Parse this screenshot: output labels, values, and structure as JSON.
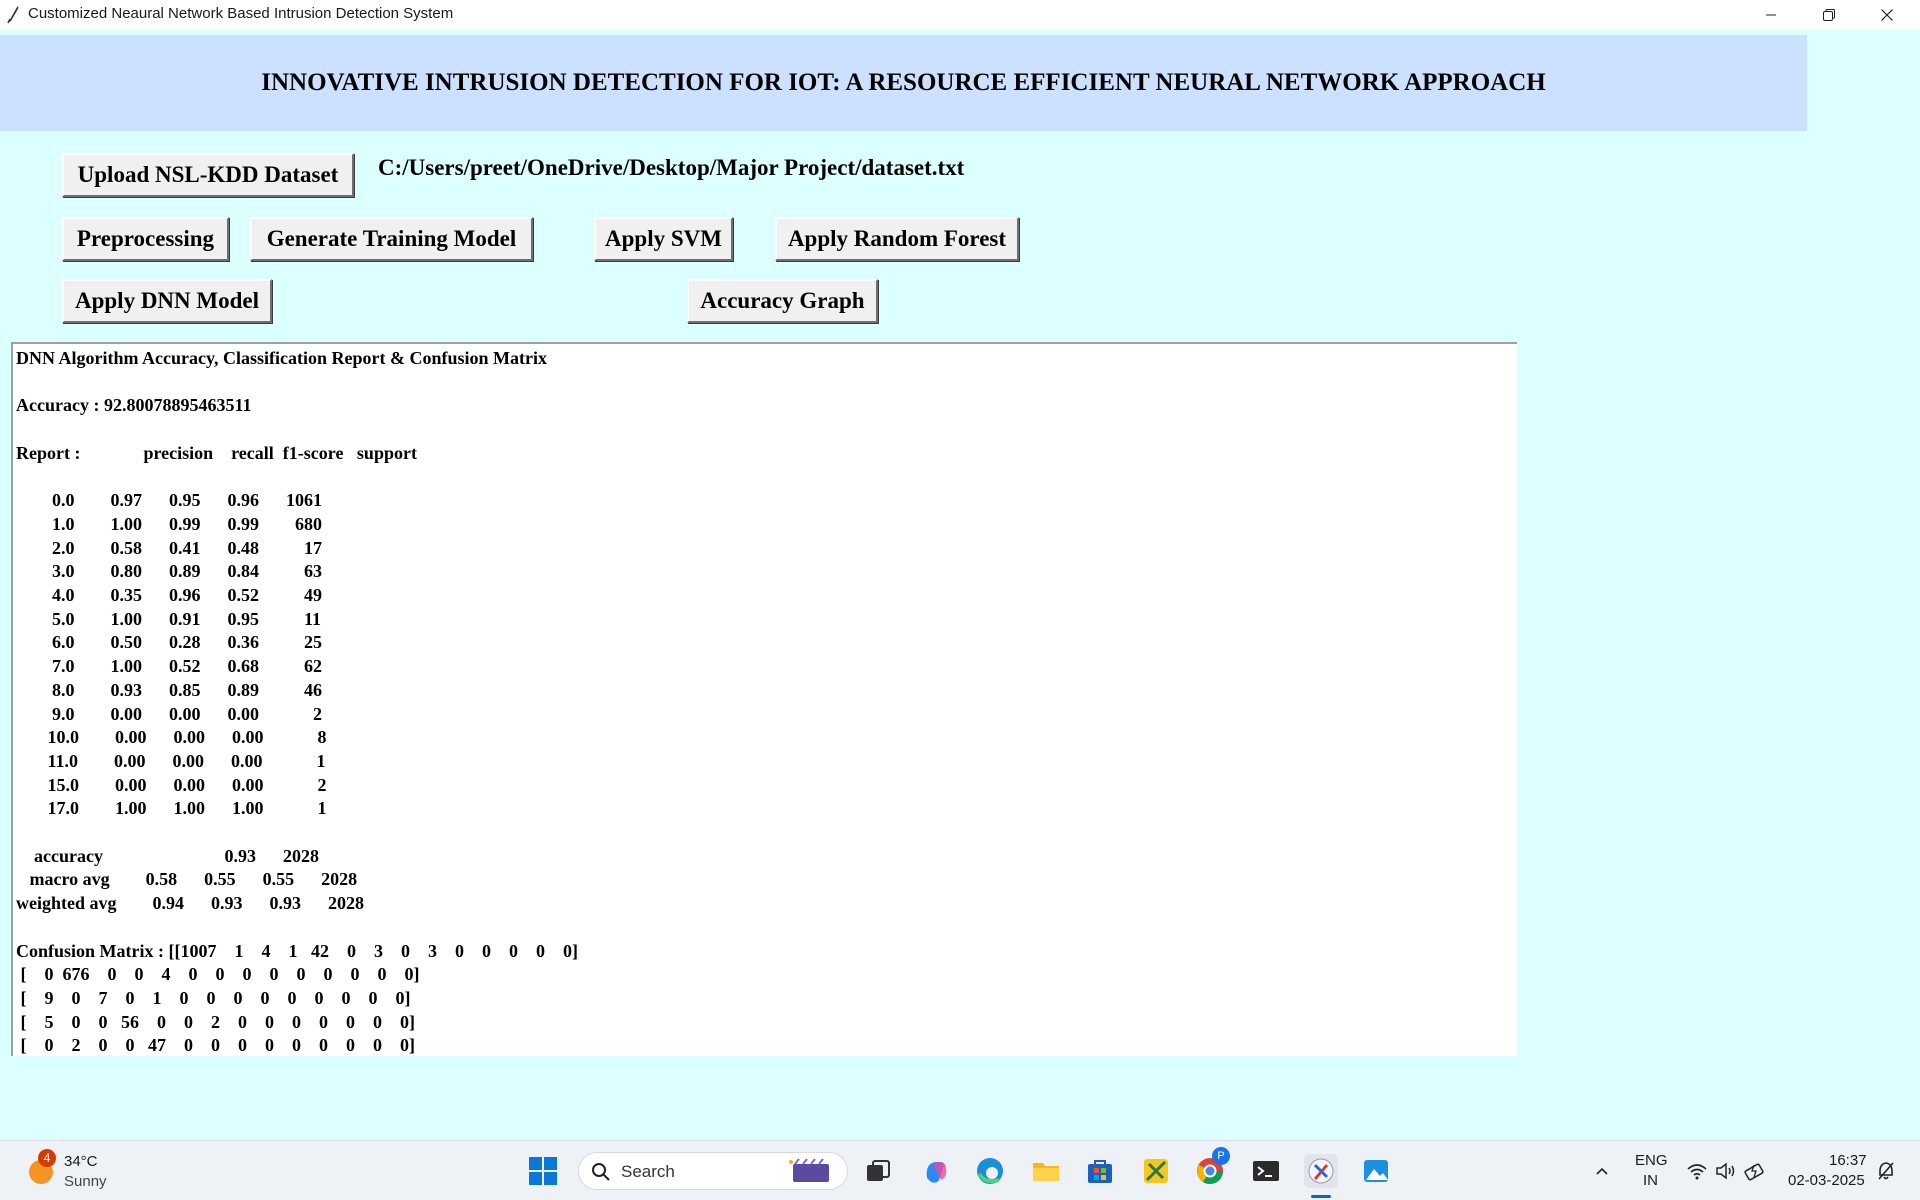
{
  "window": {
    "title": "Customized Neaural Network Based Intrusion Detection System"
  },
  "header": {
    "title": "INNOVATIVE INTRUSION DETECTION FOR IOT: A RESOURCE EFFICIENT NEURAL NETWORK APPROACH"
  },
  "buttons": {
    "upload": "Upload NSL-KDD Dataset",
    "preprocessing": "Preprocessing",
    "generate": "Generate Training Model",
    "svm": "Apply SVM",
    "random_forest": "Apply Random Forest",
    "dnn": "Apply DNN Model",
    "accuracy_graph": "Accuracy Graph"
  },
  "dataset_path": "C:/Users/preet/OneDrive/Desktop/Major Project/dataset.txt",
  "output": {
    "lines": [
      "DNN Algorithm Accuracy, Classification Report & Confusion Matrix",
      "",
      "Accuracy : 92.80078895463511",
      "",
      "Report :              precision    recall  f1-score   support",
      "",
      "        0.0        0.97      0.95      0.96      1061",
      "        1.0        1.00      0.99      0.99        680",
      "        2.0        0.58      0.41      0.48          17",
      "        3.0        0.80      0.89      0.84          63",
      "        4.0        0.35      0.96      0.52          49",
      "        5.0        1.00      0.91      0.95          11",
      "        6.0        0.50      0.28      0.36          25",
      "        7.0        1.00      0.52      0.68          62",
      "        8.0        0.93      0.85      0.89          46",
      "        9.0        0.00      0.00      0.00            2",
      "       10.0        0.00      0.00      0.00            8",
      "       11.0        0.00      0.00      0.00            1",
      "       15.0        0.00      0.00      0.00            2",
      "       17.0        1.00      1.00      1.00            1",
      "",
      "    accuracy                           0.93      2028",
      "   macro avg        0.58      0.55      0.55      2028",
      "weighted avg        0.94      0.93      0.93      2028",
      "",
      "Confusion Matrix : [[1007    1    4    1   42    0    3    0    3    0    0    0    0    0]",
      " [    0  676    0    0    4    0    0    0    0    0    0    0    0    0]",
      " [    9    0    7    0    1    0    0    0    0    0    0    0    0    0]",
      " [    5    0    0   56    0    0    2    0    0    0    0    0    0    0]",
      " [    0    2    0    0   47    0    0    0    0    0    0    0    0    0]"
    ]
  },
  "taskbar": {
    "weather_badge": "4",
    "temperature": "34°C",
    "condition": "Sunny",
    "search_placeholder": "Search",
    "language": "ENG",
    "region": "IN",
    "time": "16:37",
    "date": "02-03-2025",
    "chrome_badge": "P"
  }
}
